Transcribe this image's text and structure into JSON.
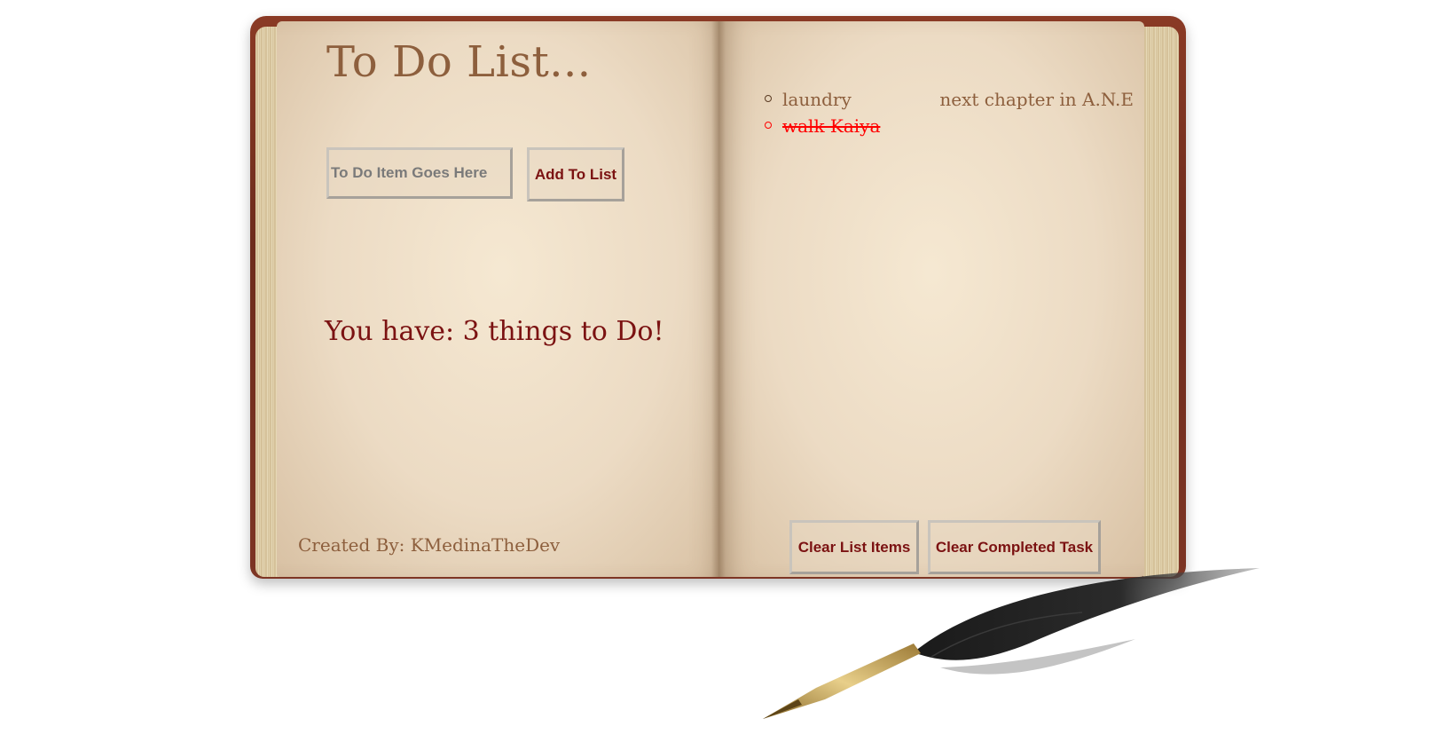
{
  "title": "To Do List...",
  "input": {
    "placeholder": "To Do Item Goes Here",
    "value": ""
  },
  "add_button": "Add To List",
  "count_text": "You have: 3 things to Do!",
  "credit": "Created By: KMedinaTheDev",
  "items": [
    {
      "label": "laundry",
      "completed": false
    },
    {
      "label": "walk Kaiya",
      "completed": true
    }
  ],
  "right_item": "next chapter in A.N.E",
  "buttons": {
    "clear_list": "Clear List Items",
    "clear_completed": "Clear Completed Task"
  },
  "colors": {
    "title": "#8d5f3d",
    "accent": "#7b1212",
    "completed": "#ff0000"
  },
  "icons": {
    "decoration": "quill-pen-icon"
  }
}
